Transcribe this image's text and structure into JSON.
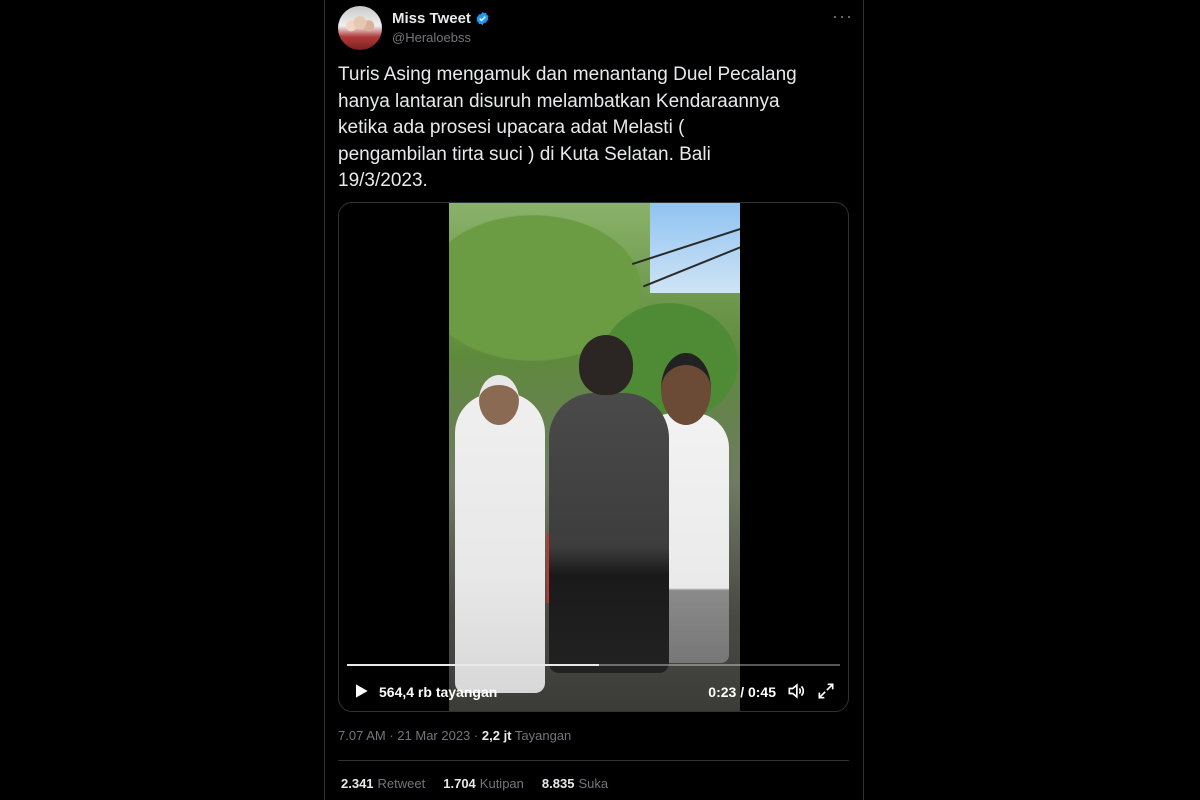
{
  "author": {
    "name": "Miss Tweet",
    "handle": "@Heraloebss",
    "verified": true
  },
  "tweet": {
    "text": "Turis Asing mengamuk dan menantang Duel Pecalang\nhanya lantaran disuruh melambatkan Kendaraannya\nketika ada prosesi upacara adat Melasti (\npengambilan tirta suci ) di Kuta Selatan. Bali\n19/3/2023."
  },
  "video": {
    "views_label": "564,4 rb tayangan",
    "time_label": "0:23 / 0:45",
    "progress": 0.5111
  },
  "meta": {
    "time": "7.07 AM",
    "date": "21 Mar 2023",
    "views_count": "2,2 jt",
    "views_label": "Tayangan",
    "separator": "·"
  },
  "stats": {
    "retweets": "2.341",
    "retweets_label": "Retweet",
    "quotes": "1.704",
    "quotes_label": "Kutipan",
    "likes": "8.835",
    "likes_label": "Suka"
  },
  "icons": {
    "verified": "verified-badge-icon",
    "more": "more-dots-icon",
    "play": "play-icon",
    "volume": "volume-icon",
    "fullscreen": "fullscreen-icon"
  },
  "colors": {
    "background": "#000000",
    "text": "#e7e9ea",
    "muted": "#71767b",
    "verified": "#1d9bf0",
    "border": "#2f3336"
  }
}
